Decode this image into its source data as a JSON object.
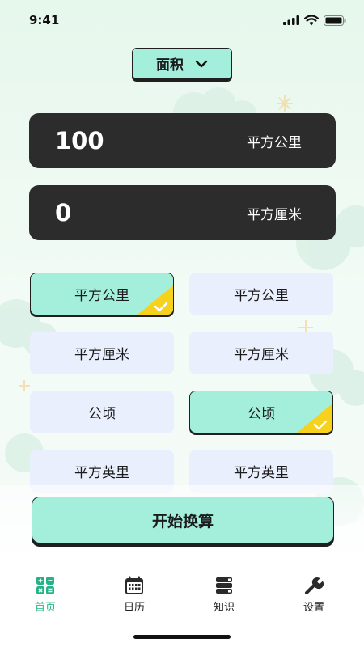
{
  "status": {
    "time": "9:41"
  },
  "category": {
    "label": "面积",
    "icon": "chevron-down-icon"
  },
  "input": {
    "value": "100",
    "unit": "平方公里"
  },
  "output": {
    "value": "0",
    "unit": "平方厘米"
  },
  "units": [
    {
      "left": "平方公里",
      "right": "平方公里"
    },
    {
      "left": "平方厘米",
      "right": "平方厘米"
    },
    {
      "left": "公顷",
      "right": "公顷"
    },
    {
      "left": "平方英里",
      "right": "平方英里"
    }
  ],
  "selection": {
    "from": "平方公里",
    "to": "公顷"
  },
  "action": {
    "label": "开始换算"
  },
  "tabs": [
    {
      "label": "首页",
      "icon": "calculator-icon",
      "active": true
    },
    {
      "label": "日历",
      "icon": "calendar-icon",
      "active": false
    },
    {
      "label": "知识",
      "icon": "books-icon",
      "active": false
    },
    {
      "label": "设置",
      "icon": "wrench-icon",
      "active": false
    }
  ],
  "colors": {
    "accent": "#a3efdc",
    "dark": "#2c2c2c",
    "option_bg": "#e9effc",
    "check": "#f7d21c",
    "active_tab": "#24b386"
  }
}
